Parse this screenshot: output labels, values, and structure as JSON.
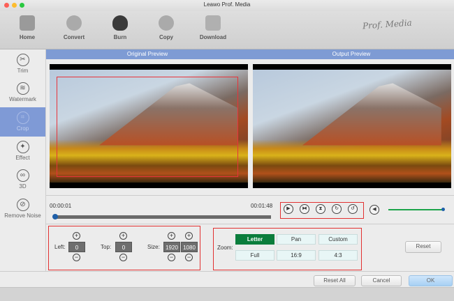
{
  "window": {
    "title": "Leawo Prof. Media"
  },
  "toolbar": {
    "items": [
      {
        "label": "Home",
        "icon": "home-icon"
      },
      {
        "label": "Convert",
        "icon": "convert-icon"
      },
      {
        "label": "Burn",
        "icon": "burn-icon"
      },
      {
        "label": "Copy",
        "icon": "copy-icon"
      },
      {
        "label": "Download",
        "icon": "download-icon"
      }
    ],
    "logo": "Prof. Media"
  },
  "sidebar": {
    "items": [
      {
        "label": "Trim"
      },
      {
        "label": "Watermark"
      },
      {
        "label": "Crop",
        "selected": true
      },
      {
        "label": "Effect"
      },
      {
        "label": "3D"
      },
      {
        "label": "Remove Noise"
      }
    ]
  },
  "preview": {
    "original_label": "Original Preview",
    "output_label": "Output Preview"
  },
  "timeline": {
    "current": "00:00:01",
    "total": "00:01:48",
    "progress": 0.0,
    "volume": 0.98
  },
  "crop": {
    "left_label": "Left:",
    "left": "0",
    "top_label": "Top:",
    "top": "0",
    "size_label": "Size:",
    "width": "1920",
    "height": "1080"
  },
  "zoom": {
    "label": "Zoom:",
    "options": [
      "Letter",
      "Pan",
      "Custom",
      "Full",
      "16:9",
      "4:3"
    ],
    "selected": "Letter"
  },
  "buttons": {
    "reset": "Reset",
    "reset_all": "Reset All",
    "cancel": "Cancel",
    "ok": "OK"
  },
  "colors": {
    "accent": "#7e9bd4",
    "selected_zoom": "#0b7d3c",
    "highlight": "#e23030",
    "volume": "#1aa34a"
  }
}
